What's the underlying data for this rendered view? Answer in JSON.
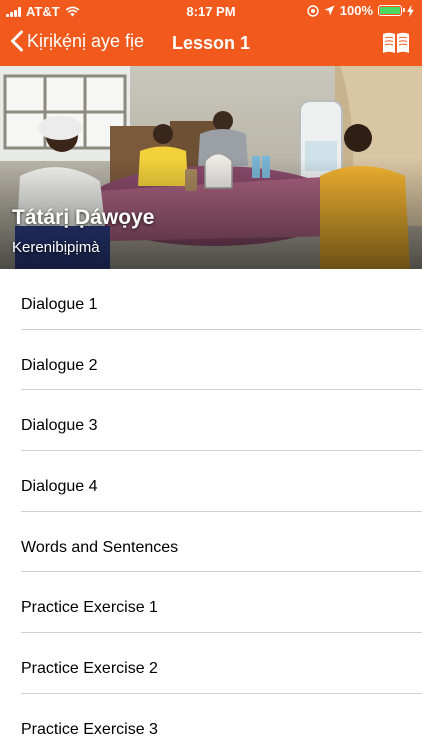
{
  "status_bar": {
    "carrier": "AT&T",
    "time": "8:17 PM",
    "battery_percent": "100%",
    "battery_level": 1.0,
    "icons": [
      "signal-icon",
      "wifi-icon",
      "location-lock-icon",
      "location-arrow-icon",
      "battery-icon",
      "charging-bolt-icon"
    ]
  },
  "nav": {
    "back_label": "Kịrịkẹ́nị aye fịe",
    "back_icon": "chevron-left-icon",
    "title": "Lesson 1",
    "book_icon": "open-book-icon"
  },
  "hero": {
    "title": "Tátárị Ḍáwọye",
    "subtitle": "Kerenibịpịmà"
  },
  "list": {
    "items": [
      "Dialogue 1",
      "Dialogue 2",
      "Dialogue 3",
      "Dialogue 4",
      "Words and Sentences",
      "Practice Exercise 1",
      "Practice Exercise 2",
      "Practice Exercise 3"
    ]
  },
  "colors": {
    "accent": "#f15a1c",
    "battery": "#4cd964",
    "divider": "#cfcfcf"
  }
}
